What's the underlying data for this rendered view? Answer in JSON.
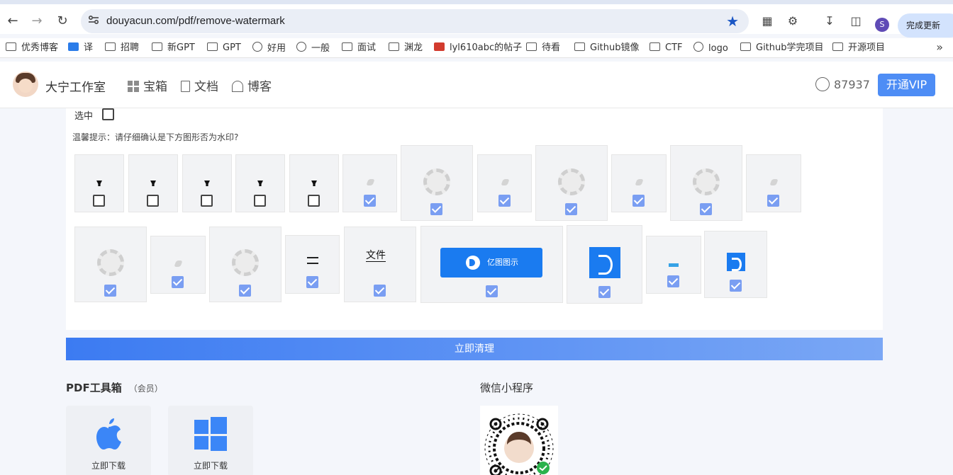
{
  "browser": {
    "url": "douyacun.com/pdf/remove-watermark",
    "profile_initial": "S",
    "update_label": "完成更新",
    "bookmarks": [
      {
        "label": "优秀博客",
        "icon": "folder-icon"
      },
      {
        "label": "译",
        "icon": "translate-icon"
      },
      {
        "label": "招聘",
        "icon": "folder-icon"
      },
      {
        "label": "新GPT",
        "icon": "folder-icon"
      },
      {
        "label": "GPT",
        "icon": "folder-icon"
      },
      {
        "label": "好用",
        "icon": "openai-icon"
      },
      {
        "label": "一般",
        "icon": "openai-icon"
      },
      {
        "label": "面试",
        "icon": "folder-icon"
      },
      {
        "label": "渊龙",
        "icon": "folder-icon"
      },
      {
        "label": "lyl610abc的帖子",
        "icon": "forum-icon"
      },
      {
        "label": "待看",
        "icon": "folder-icon"
      },
      {
        "label": "Github镜像",
        "icon": "folder-icon"
      },
      {
        "label": "CTF",
        "icon": "folder-icon"
      },
      {
        "label": "logo",
        "icon": "globe-icon"
      },
      {
        "label": "Github学完项目",
        "icon": "folder-icon"
      },
      {
        "label": "开源项目",
        "icon": "folder-icon"
      }
    ]
  },
  "header": {
    "brand": "大宁工作室",
    "nav": [
      {
        "label": "宝箱",
        "icon": "grid-icon"
      },
      {
        "label": "文档",
        "icon": "document-icon"
      },
      {
        "label": "博客",
        "icon": "home-icon"
      }
    ],
    "user_count": "87937",
    "vip_label": "开通VIP"
  },
  "panel": {
    "select_label": "选中",
    "select_checked": false,
    "tip": "温馨提示：请仔细确认是下方图形否为水印?",
    "tiles": [
      {
        "mark": "tee-icon",
        "checked": false
      },
      {
        "mark": "tee-icon",
        "checked": false
      },
      {
        "mark": "tee-icon",
        "checked": false
      },
      {
        "mark": "tee-icon",
        "checked": false
      },
      {
        "mark": "tee-icon",
        "checked": false
      },
      {
        "mark": "faint-mark",
        "checked": true
      },
      {
        "mark": "swirl-watermark",
        "checked": true
      },
      {
        "mark": "faint-mark",
        "checked": true
      },
      {
        "mark": "swirl-watermark",
        "checked": true
      },
      {
        "mark": "faint-mark",
        "checked": true
      },
      {
        "mark": "swirl-watermark",
        "checked": true
      },
      {
        "mark": "faint-mark",
        "checked": true
      },
      {
        "mark": "swirl-watermark",
        "checked": true
      },
      {
        "mark": "faint-mark",
        "checked": true
      },
      {
        "mark": "swirl-watermark",
        "checked": true
      },
      {
        "mark": "line-mark",
        "checked": true
      },
      {
        "mark": "text-mark",
        "text": "文件",
        "checked": true
      },
      {
        "mark": "banner-logo",
        "text": "亿图图示",
        "checked": true
      },
      {
        "mark": "brand-logo",
        "checked": true
      },
      {
        "mark": "bar-mark",
        "checked": true
      },
      {
        "mark": "brand-logo",
        "checked": true
      }
    ]
  },
  "clean_button": "立即清理",
  "toolbox": {
    "title": "PDF工具箱",
    "subtitle": "（会员）",
    "downloads": [
      {
        "label": "立即下载",
        "icon": "apple-icon"
      },
      {
        "label": "立即下载",
        "icon": "windows-icon"
      }
    ]
  },
  "miniprogram": {
    "title": "微信小程序",
    "qr_icon": "wechat-qr-code"
  },
  "colors": {
    "accent": "#4e8df5",
    "checkbox_on": "#7a9ef2",
    "brand_blue": "#1a7bf0"
  }
}
